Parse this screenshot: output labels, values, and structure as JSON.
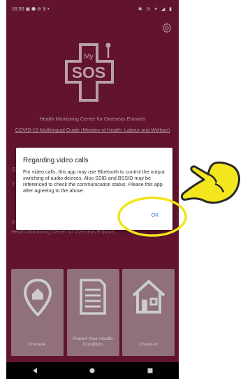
{
  "status_bar": {
    "time": "16:50",
    "left_icons": "▣ ⬢ ⊘ ⊻ •",
    "right_icons": "✱ ⊙ ▾ ◢ ▮"
  },
  "app": {
    "logo_small": "My",
    "logo_main": "SOS",
    "center_name": "Health Monitoring Center for Overseas Entrants",
    "guide_link": "COVID-19 Multilingual Guide (Ministry of Health, Labour and Welfare)"
  },
  "background_fragments": {
    "q": "Q",
    "t": "T",
    "i": "II",
    "footer": "Health Monitoring Center for Overseas Entrants"
  },
  "dialog": {
    "title": "Regarding video calls",
    "message": "For video calls, this app may use Bluetooth to control the output switching of audio devices. Also SSID and BSSID may be referenced to check the communication status. Please this app after agreeing to the above.",
    "ok_label": "OK"
  },
  "tiles": [
    {
      "label": "I'm here"
    },
    {
      "label": "Report Your Health Condition"
    },
    {
      "label": "Check-in"
    }
  ],
  "colors": {
    "primary": "#7b1a3a",
    "tile": "#b58c9a",
    "highlight": "#f0e61a",
    "accent_link": "#1e73d8"
  }
}
